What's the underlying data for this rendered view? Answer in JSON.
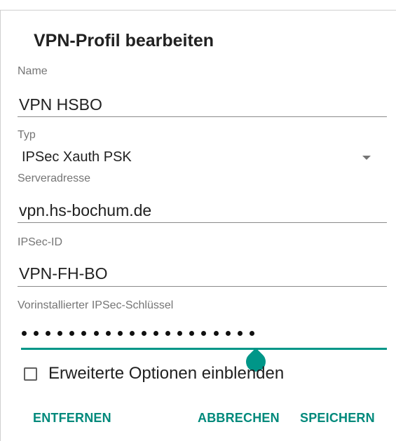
{
  "dialog": {
    "title": "VPN-Profil bearbeiten"
  },
  "fields": {
    "name": {
      "label": "Name",
      "value": "VPN HSBO"
    },
    "type": {
      "label": "Typ",
      "value": "IPSec Xauth PSK"
    },
    "server": {
      "label": "Serveradresse",
      "value": "vpn.hs-bochum.de"
    },
    "ipsec_id": {
      "label": "IPSec-ID",
      "value": "VPN-FH-BO"
    },
    "psk": {
      "label": "Vorinstallierter IPSec-Schlüssel",
      "masked_length": 20
    }
  },
  "advanced": {
    "label": "Erweiterte Optionen einblenden",
    "checked": false
  },
  "buttons": {
    "remove": "ENTFERNEN",
    "cancel": "ABBRECHEN",
    "save": "SPEICHERN"
  },
  "colors": {
    "accent": "#009688",
    "button_text": "#00897b"
  },
  "icons": {
    "dropdown": "dropdown-arrow-icon",
    "text_cursor": "text-cursor-handle-icon"
  }
}
